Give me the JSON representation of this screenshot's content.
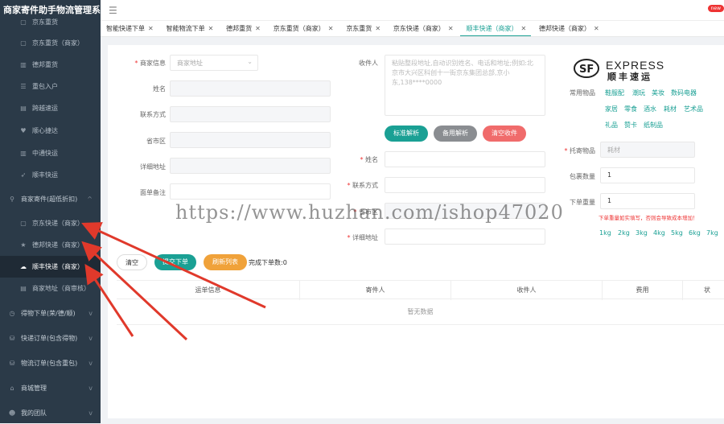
{
  "app_title": "商家寄件助手物流管理系统",
  "header": {
    "badge": "new"
  },
  "sidebar": {
    "items": [
      {
        "label": "京东重货",
        "icon": "cube-icon"
      },
      {
        "label": "京东重货（商家）",
        "icon": "cube-icon"
      },
      {
        "label": "德邦重货",
        "icon": "chart-icon"
      },
      {
        "label": "重包入户",
        "icon": "list-icon"
      },
      {
        "label": "跨越速运",
        "icon": "doc-icon"
      },
      {
        "label": "顺心捷达",
        "icon": "heart-icon"
      },
      {
        "label": "中通快运",
        "icon": "chart-icon"
      },
      {
        "label": "顺丰快运",
        "icon": "send-icon"
      },
      {
        "label": "商家寄件(超低折扣)",
        "icon": "hierarchy-icon"
      },
      {
        "label": "京东快递（商家）",
        "icon": "doc-icon"
      },
      {
        "label": "德邦快递（商家）",
        "icon": "star-icon"
      },
      {
        "label": "顺丰快递（商家）",
        "icon": "cloud-icon"
      },
      {
        "label": "商家地址（商审核）",
        "icon": "doc-icon"
      },
      {
        "label": "得物下单(荣/德/顺)",
        "icon": "clock-icon"
      },
      {
        "label": "快递订单(包含得物)",
        "icon": "db-icon"
      },
      {
        "label": "物流订单(包含重包)",
        "icon": "db-icon"
      },
      {
        "label": "商城管理",
        "icon": "home-icon"
      },
      {
        "label": "我的团队",
        "icon": "user-icon"
      }
    ]
  },
  "tabs": [
    {
      "label": "智能快递下单"
    },
    {
      "label": "智能物流下单"
    },
    {
      "label": "德邦重货"
    },
    {
      "label": "京东重货（商家）"
    },
    {
      "label": "京东重货"
    },
    {
      "label": "京东快递（商家）"
    },
    {
      "label": "顺丰快递（商家）"
    },
    {
      "label": "德邦快递（商家）"
    }
  ],
  "form": {
    "merchant_info_label": "商家信息",
    "merchant_select_placeholder": "商家地址",
    "name_label": "姓名",
    "contact_label": "联系方式",
    "region_label": "省市区",
    "address_label": "详细地址",
    "note_label": "面单备注",
    "receiver_label": "收件人",
    "receiver_placeholder": "粘贴整段地址,自动识别姓名、电话和地址;例如:北京市大兴区科创十一街京东集团总部,京小东,138****0000",
    "btn_parse": "标准解析",
    "btn_backup_parse": "备用解析",
    "btn_clear_receiver": "清空收件",
    "r_name_label": "姓名",
    "r_contact_label": "联系方式",
    "r_region_label": "省市区",
    "r_address_label": "详细地址"
  },
  "right": {
    "logo_en": "EXPRESS",
    "logo_cn": "顺丰速运",
    "common_items_label": "常用物品",
    "chips": [
      "鞋服配",
      "潮玩",
      "美妆",
      "数码电器",
      "家居",
      "零食",
      "酒水",
      "耗材",
      "艺术品",
      "礼品",
      "赞卡",
      "纸制品"
    ],
    "goods_label": "托寄物品",
    "goods_value": "耗材",
    "parcel_count_label": "包裹数量",
    "parcel_count_value": "1",
    "weight_label": "下单重量",
    "weight_value": "1",
    "weight_warning": "下单重量如实填写，否则会导致成本增加！",
    "kg_options": [
      "1kg",
      "2kg",
      "3kg",
      "4kg",
      "5kg",
      "6kg",
      "7kg"
    ]
  },
  "actions": {
    "clear": "清空",
    "submit": "提交下单",
    "refresh": "刷新列表",
    "done_count": "完成下单数:0"
  },
  "table": {
    "columns": [
      "运单信息",
      "寄件人",
      "收件人",
      "费用",
      "状"
    ],
    "empty_text": "暂无数据"
  },
  "watermark": "https://www.huzhan.com/ishop47020",
  "colors": {
    "accent": "#1aa094",
    "sidebar": "#2b3a48",
    "orange": "#f0a23a",
    "gray_btn": "#8a8d91",
    "red_btn": "#f06b6b",
    "arrow": "#e0392b"
  }
}
